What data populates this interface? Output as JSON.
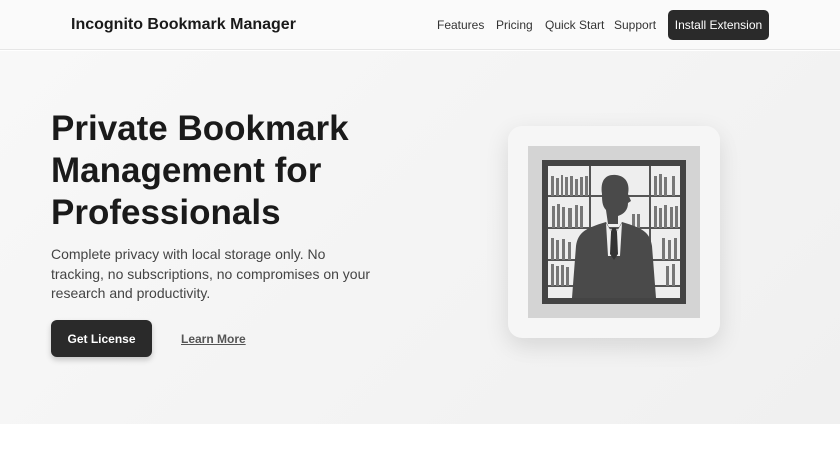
{
  "header": {
    "brand": "Incognito Bookmark Manager",
    "links": [
      "Features",
      "Pricing",
      "Quick Start",
      "Support"
    ],
    "install_label": "Install Extension"
  },
  "hero": {
    "title": "Private Bookmark Management for Professionals",
    "description": "Complete privacy with local storage only. No tracking, no subscriptions, no compromises on your research and productivity.",
    "primary_label": "Get License",
    "secondary_label": "Learn More"
  },
  "colors": {
    "accent": "#2a2a2a",
    "hero_bg": "#f4f4f4"
  }
}
